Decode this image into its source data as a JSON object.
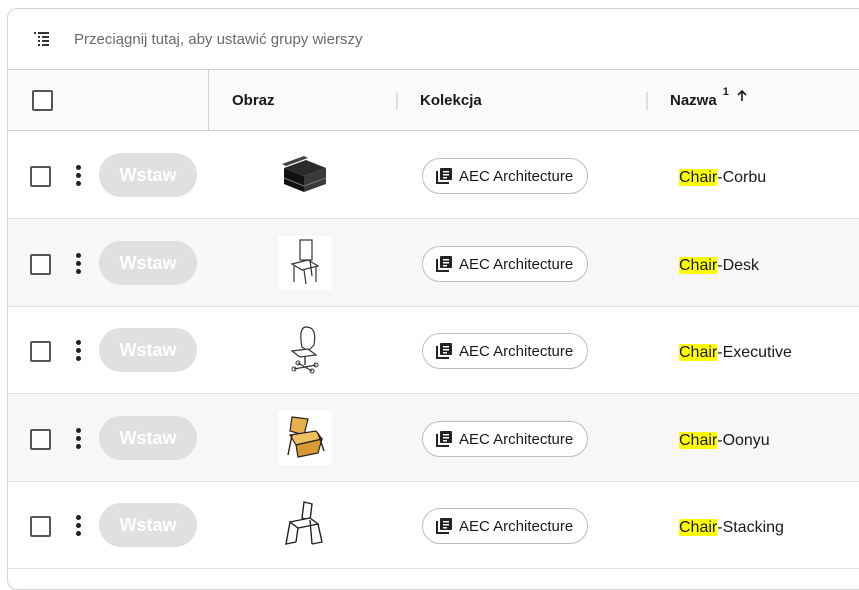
{
  "group_bar": {
    "placeholder": "Przeciągnij tutaj, aby ustawić grupy wierszy"
  },
  "columns": {
    "image": "Obraz",
    "collection": "Kolekcja",
    "name": "Nazwa",
    "name_sort_index": "1",
    "name_sort_icon": "arrow-up-icon"
  },
  "rows": [
    {
      "insert_label": "Wstaw",
      "collection": "AEC Architecture",
      "name_highlight": "Chair",
      "name_rest": "-Corbu",
      "thumb": "sofa-chair"
    },
    {
      "insert_label": "Wstaw",
      "collection": "AEC Architecture",
      "name_highlight": "Chair",
      "name_rest": "-Desk",
      "thumb": "desk-chair"
    },
    {
      "insert_label": "Wstaw",
      "collection": "AEC Architecture",
      "name_highlight": "Chair",
      "name_rest": "-Executive",
      "thumb": "executive-chair"
    },
    {
      "insert_label": "Wstaw",
      "collection": "AEC Architecture",
      "name_highlight": "Chair",
      "name_rest": "-Oonyu",
      "thumb": "oonyu-chair"
    },
    {
      "insert_label": "Wstaw",
      "collection": "AEC Architecture",
      "name_highlight": "Chair",
      "name_rest": "-Stacking",
      "thumb": "stacking-chair"
    }
  ],
  "colors": {
    "highlight": "#ffff00",
    "insert_button_bg": "#e0e0e0",
    "border": "#d4d4d4"
  }
}
